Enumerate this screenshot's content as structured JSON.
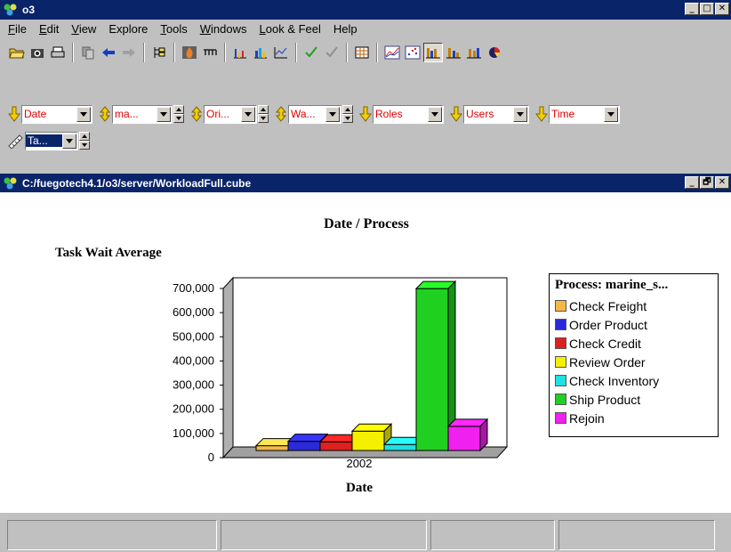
{
  "window": {
    "title": "o3",
    "minimize_label": "_",
    "maximize_label": "□",
    "close_label": "✕"
  },
  "menu": [
    {
      "underline": "F",
      "rest": "ile"
    },
    {
      "underline": "E",
      "rest": "dit"
    },
    {
      "underline": "V",
      "rest": "iew"
    },
    {
      "underline": "",
      "rest": "Explore"
    },
    {
      "underline": "T",
      "rest": "ools"
    },
    {
      "underline": "W",
      "rest": "indows"
    },
    {
      "underline": "L",
      "rest": "ook & Feel"
    },
    {
      "underline": "",
      "rest": "Help"
    }
  ],
  "toolbar_icons": [
    "open-folder-icon",
    "camera-icon",
    "print-icon",
    "sep",
    "copy-icon",
    "back-arrow-icon",
    "forward-arrow-icon",
    "sep",
    "tree-icon",
    "sep",
    "fire-icon",
    "chain-icon",
    "sep",
    "bar-chart-icon",
    "grouped-bar-icon",
    "line-step-icon",
    "sep",
    "check-icon",
    "check-outline-icon",
    "sep",
    "grid-icon",
    "sep",
    "line-chart-icon",
    "scatter-chart-icon",
    "bar3d-chart-icon",
    "stacked-bar-icon",
    "column-chart-icon",
    "pie-chart-icon"
  ],
  "dimensions_row1": [
    {
      "label": "Date",
      "has_spin": false,
      "width": 62
    },
    {
      "label": "ma...",
      "has_spin": true,
      "width": 50
    },
    {
      "label": "Ori...",
      "has_spin": true,
      "width": 42
    },
    {
      "label": "Wa...",
      "has_spin": true,
      "width": 42
    },
    {
      "label": "Roles",
      "has_spin": false,
      "width": 62
    },
    {
      "label": "Users",
      "has_spin": false,
      "width": 56
    },
    {
      "label": "Time",
      "has_spin": false,
      "width": 62
    }
  ],
  "dimensions_row2": [
    {
      "label": "Ta...",
      "has_spin": true,
      "width": 42
    }
  ],
  "inner_window": {
    "title": "C:/fuegotech4.1/o3/server/WorkloadFull.cube",
    "minimize_label": "_",
    "restore_label": "🗗",
    "close_label": "✕"
  },
  "colors": {
    "titlebar": "#0a246a",
    "dimension_text": "#e00000",
    "face": "#d4d0c8"
  },
  "chart_data": {
    "type": "bar",
    "title": "Date / Process",
    "ylabel": "Task Wait Average",
    "xlabel": "Date",
    "categories": [
      "2002"
    ],
    "ylim": [
      0,
      700000
    ],
    "yticks": [
      "700,000",
      "600,000",
      "500,000",
      "400,000",
      "300,000",
      "200,000",
      "100,000",
      "0"
    ],
    "legend_title": "Process: marine_s...",
    "series": [
      {
        "name": "Check Freight",
        "values": [
          20000
        ],
        "color": "#f4b844"
      },
      {
        "name": "Order Product",
        "values": [
          38000
        ],
        "color": "#2a2ad8"
      },
      {
        "name": "Check Credit",
        "values": [
          36000
        ],
        "color": "#dd2020"
      },
      {
        "name": "Review Order",
        "values": [
          80000
        ],
        "color": "#f4f000"
      },
      {
        "name": "Check Inventory",
        "values": [
          25000
        ],
        "color": "#20e0e0"
      },
      {
        "name": "Ship Product",
        "values": [
          670000
        ],
        "color": "#20d020"
      },
      {
        "name": "Rejoin",
        "values": [
          100000
        ],
        "color": "#f020f0"
      }
    ]
  }
}
